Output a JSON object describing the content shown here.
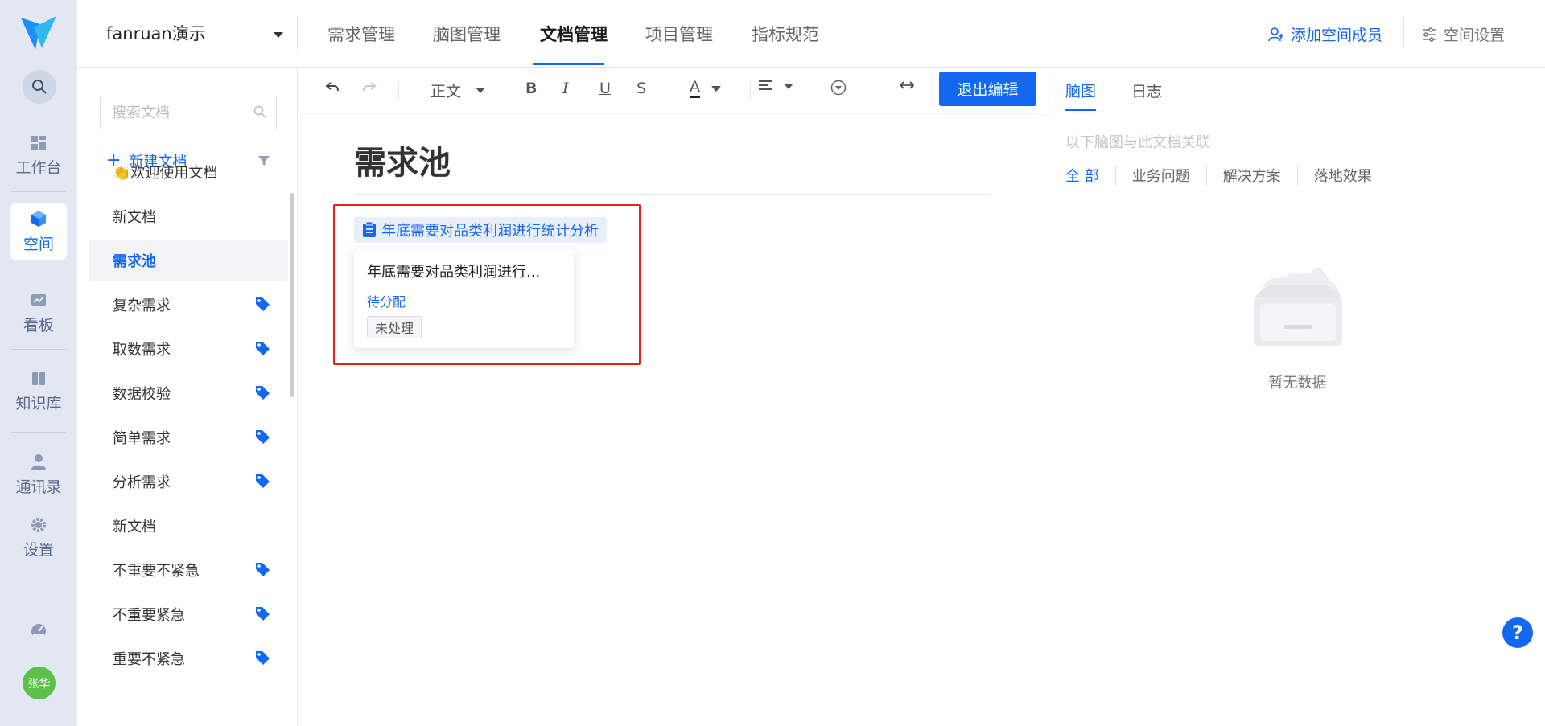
{
  "rail": {
    "items": [
      {
        "label": "工作台",
        "icon": "dashboard-icon"
      },
      {
        "label": "空间",
        "icon": "cube-icon",
        "active": true
      },
      {
        "label": "看板",
        "icon": "chart-board-icon"
      },
      {
        "label": "知识库",
        "icon": "book-icon"
      },
      {
        "label": "通讯录",
        "icon": "contacts-icon"
      },
      {
        "label": "设置",
        "icon": "gear-icon"
      }
    ],
    "avatar_text": "张华"
  },
  "header": {
    "space_name": "fanruan演示",
    "tabs": [
      "需求管理",
      "脑图管理",
      "文档管理",
      "项目管理",
      "指标规范"
    ],
    "active_tab": "文档管理",
    "add_member": "添加空间成员",
    "space_settings": "空间设置"
  },
  "sidebar": {
    "search_placeholder": "搜索文档",
    "new_doc": "新建文档",
    "docs": [
      {
        "label": "👏欢迎使用文档",
        "tag": false
      },
      {
        "label": "新文档",
        "tag": false
      },
      {
        "label": "需求池",
        "tag": false,
        "active": true
      },
      {
        "label": "复杂需求",
        "tag": true
      },
      {
        "label": "取数需求",
        "tag": true
      },
      {
        "label": "数据校验",
        "tag": true
      },
      {
        "label": "简单需求",
        "tag": true
      },
      {
        "label": "分析需求",
        "tag": true
      },
      {
        "label": "新文档",
        "tag": false
      },
      {
        "label": "不重要不紧急",
        "tag": true
      },
      {
        "label": "不重要紧急",
        "tag": true
      },
      {
        "label": "重要不紧急",
        "tag": true
      }
    ]
  },
  "toolbar": {
    "paragraph_style": "正文",
    "bold": "B",
    "italic": "I",
    "underline": "U",
    "strike": "S",
    "font_color": "A",
    "exit_label": "退出编辑"
  },
  "document": {
    "title": "需求池",
    "linked_item": "年底需要对品类利润进行统计分析",
    "card": {
      "title": "年底需要对品类利润进行...",
      "assignee_status": "待分配",
      "state_badge": "未处理"
    }
  },
  "right_panel": {
    "tabs": [
      "脑图",
      "日志"
    ],
    "active_tab": "脑图",
    "hint": "以下脑图与此文档关联",
    "filters": [
      "全 部",
      "业务问题",
      "解决方案",
      "落地效果"
    ],
    "empty_text": "暂无数据"
  },
  "help": "?",
  "colors": {
    "accent": "#1468f0",
    "highlight_border": "#e72020",
    "avatar": "#5cc14a"
  }
}
